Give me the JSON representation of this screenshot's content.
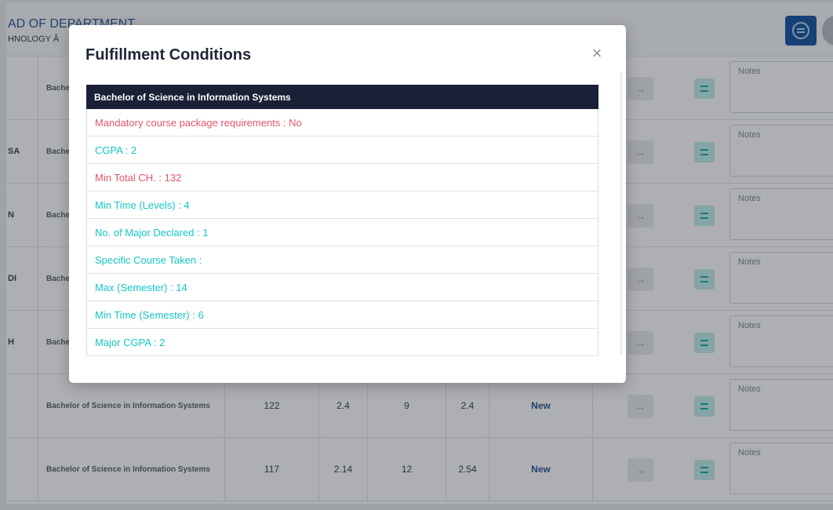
{
  "header": {
    "dept_title": "AD OF DEPARTMENT",
    "dept_subtitle": "HNOLOGY   Â"
  },
  "table": {
    "rows": [
      {
        "name": "",
        "program": "Bachel",
        "v1": "",
        "v2": "",
        "v3": "",
        "v4": "",
        "status": "",
        "notes": "Notes"
      },
      {
        "name": "SA",
        "program": "Bachel",
        "v1": "",
        "v2": "",
        "v3": "",
        "v4": "",
        "status": "",
        "notes": "Notes"
      },
      {
        "name": "N",
        "program": "Bachel",
        "v1": "",
        "v2": "",
        "v3": "",
        "v4": "",
        "status": "",
        "notes": "Notes"
      },
      {
        "name": "DI",
        "program": "Bachel",
        "v1": "",
        "v2": "",
        "v3": "",
        "v4": "",
        "status": "",
        "notes": "Notes"
      },
      {
        "name": "H",
        "program": "Bachel",
        "v1": "",
        "v2": "",
        "v3": "",
        "v4": "",
        "status": "",
        "notes": "Notes"
      },
      {
        "name": "",
        "program": "Bachelor of Science in Information Systems",
        "v1": "122",
        "v2": "2.4",
        "v3": "9",
        "v4": "2.4",
        "status": "New",
        "notes": "Notes"
      },
      {
        "name": "",
        "program": "Bachelor of Science in Information Systems",
        "v1": "117",
        "v2": "2.14",
        "v3": "12",
        "v4": "2.54",
        "status": "New",
        "notes": "Notes"
      }
    ],
    "arrow_icon": "→"
  },
  "modal": {
    "title": "Fulfillment Conditions",
    "close_icon": "×",
    "program_header": "Bachelor of Science in Information Systems",
    "conditions": [
      {
        "text": "Mandatory course package requirements : No",
        "status": "unmet"
      },
      {
        "text": "CGPA : 2",
        "status": "met"
      },
      {
        "text": "Min Total CH. : 132",
        "status": "unmet"
      },
      {
        "text": "Min Time (Levels) : 4",
        "status": "met"
      },
      {
        "text": "No. of Major Declared : 1",
        "status": "met"
      },
      {
        "text": "Specific Course Taken :",
        "status": "met"
      },
      {
        "text": "Max (Semester) : 14",
        "status": "met"
      },
      {
        "text": "Min Time (Semester) : 6",
        "status": "met"
      },
      {
        "text": "Major CGPA : 2",
        "status": "met"
      }
    ]
  },
  "colors": {
    "met": "#14c6c6",
    "unmet": "#e5566a",
    "header_bg": "#1a2035",
    "brand": "#0b4e9e"
  }
}
